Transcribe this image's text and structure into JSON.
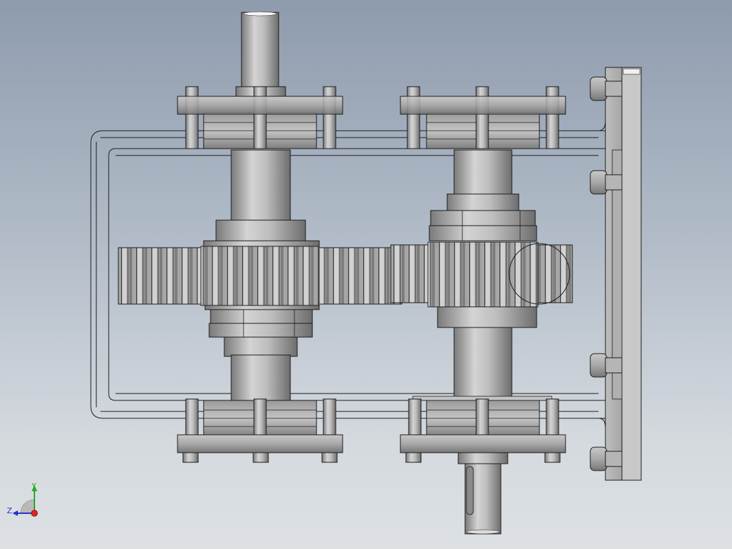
{
  "viewport": {
    "background_top": "#8e9bad",
    "background_bottom": "#dde1e4"
  },
  "model": {
    "description_icon": "gearbox-assembly-icon",
    "colors": {
      "metal_light": "#c9c9c9",
      "metal_mid": "#a9a9a9",
      "metal_dark": "#6e6e6e",
      "edge": "#1a1a1a"
    }
  },
  "triad": {
    "y_label": "Y",
    "z_label": "Z",
    "colors": {
      "y": "#22aa22",
      "z": "#2233cc",
      "x": "#dd2222"
    }
  }
}
